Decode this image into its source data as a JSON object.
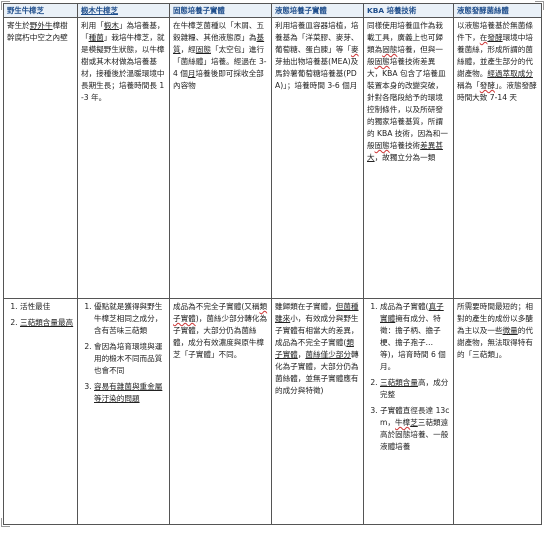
{
  "headers": [
    "野生牛樟芝",
    "椴木牛樟芝",
    "固態培養子實體",
    "液態培養子實體",
    "KBA 培養技術",
    "液態發酵菌絲體"
  ],
  "row1": [
    [
      "寄生於",
      "野外牛",
      "樟樹",
      "幹腐朽中空之內壁"
    ],
    [
      "利用「",
      "椴木",
      "」為培養基，「",
      "種菌",
      "」栽培牛樟芝，就是模擬野生狀態，以牛樟樹或其木材做為培養基材，接種後於溫暖環境中長期生長；培養時間長 1-3 年。"
    ],
    [
      "在牛樟芝菌種以「木屑、五穀雜糧、其他液態原」為",
      "基質",
      "，經",
      "固態",
      "「太空包」進行「菌絲體」培養。經過在 3-4 個",
      "月",
      "培養後即可採收全部內容物"
    ],
    [
      "利用培養皿容器培植，培養基為「洋菜膠、麥芽、葡萄糖、蛋白腖」等「",
      "麥",
      "芽抽出物培養基(MEA)及馬鈴薯葡萄糖培養基(PDA)」；培養時間 3-6 個月"
    ],
    [
      "同樣使用培養皿作為栽載工具，廣義上也可歸類為",
      "固態",
      "培養，但與一般",
      "固態",
      "培養技術差異大，KBA 包含了培養皿裝置本身的改變突破，針對各階段給予的環境控制條件，以及所研發的獨家培養基質，所謂的 KBA 技術，因為和一般",
      "固態",
      "培養技術",
      "差異甚大",
      "，故獨立分為一類"
    ],
    [
      "以液態培養基於無菌條件下，",
      "在",
      "",
      "發酵",
      "環境中培養菌絲，形成所謂的菌絲體，並產生部分的代謝產物。",
      "經過萃取成分",
      "稱為「",
      "發酵",
      "」。液態發酵時間大致 7-14 天"
    ]
  ],
  "row2": {
    "c1": [
      "活性最佳",
      "三萜類含量最高"
    ],
    "c2": [
      "優點就是獲得與野生牛樟芝相同之成分，含有苦味三萜類",
      "會因為培育環境與運用的椴木不同而品質也會不同",
      "容易有雜菌與重金屬等汙染的問題"
    ],
    "c3": [
      "成品為不完全子實體(又稱",
      "類子實體",
      ")，菌絲少部分轉化為子實體，大部分仍為菌絲體，成分有效濃度與原牛樟芝「子實體」不同。"
    ],
    "c4": [
      "雖歸類在子實體，",
      "但菌種雖來",
      "小，有效成分與野生子實體有相當大的差異，成品為不完全子實體(",
      "類子實體",
      "，",
      "菌絲僅",
      "少部分",
      "轉化為子實體，大部分仍為菌絲體，並無子實體應有的成分與特徵)"
    ],
    "c5": [
      "成品為子實體(",
      "真子實體",
      "擁有成分、特徵：擔子柄、擔子梗、擔子孢子…等)，培育時間 6 個月。",
      "三萜類含量",
      "高，成分完整",
      "子實體直徑長達 13cm，",
      "牛樟",
      "芝",
      "三萜類",
      "遠高於固態培養、一般液體培養"
    ],
    "c6": [
      "所需要時間最短的；相對的產生的成份以多醣為主以及一些",
      "微量",
      "的",
      "代謝產物，無法取得",
      "特有的「三萜類」。"
    ]
  }
}
